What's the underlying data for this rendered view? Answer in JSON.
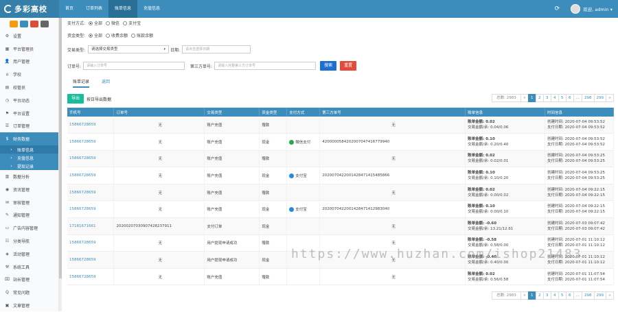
{
  "app": {
    "logo_text": "多彩高校"
  },
  "topnav": {
    "items": [
      {
        "label": "首页",
        "active": false
      },
      {
        "label": "订单列表",
        "active": false
      },
      {
        "label": "账单信息",
        "active": true
      },
      {
        "label": "充值信息",
        "active": false
      }
    ]
  },
  "user": {
    "refresh_icon": "⟳",
    "greeting": "欢迎, admin ▾"
  },
  "sidebar": {
    "items": [
      {
        "icon": "⚙",
        "label": "设置"
      },
      {
        "icon": "▦",
        "label": "平台管理员"
      },
      {
        "icon": "👤",
        "label": "用户管理"
      },
      {
        "icon": "⌂",
        "label": "学校"
      },
      {
        "icon": "▤",
        "label": "校管员"
      },
      {
        "icon": "◷",
        "label": "平台动态"
      },
      {
        "icon": "⚑",
        "label": "平台设置"
      },
      {
        "icon": "☰",
        "label": "订单管理"
      },
      {
        "icon": "$",
        "label": "财务数据",
        "open": true
      },
      {
        "icon": "›",
        "label": "账单信息",
        "sub": true,
        "active": true
      },
      {
        "icon": "›",
        "label": "充值信息",
        "sub": true
      },
      {
        "icon": "›",
        "label": "提现记录",
        "sub": true
      },
      {
        "icon": "▥",
        "label": "数据分析"
      },
      {
        "icon": "◉",
        "label": "资讯管理"
      },
      {
        "icon": "✉",
        "label": "审核管理"
      },
      {
        "icon": "✎",
        "label": "通知管理"
      },
      {
        "icon": "▭",
        "label": "广告内容管理"
      },
      {
        "icon": "☷",
        "label": "分类导航"
      },
      {
        "icon": "◈",
        "label": "活动管理"
      },
      {
        "icon": "⚒",
        "label": "系统工具"
      },
      {
        "icon": "⌧",
        "label": "站长管理"
      },
      {
        "icon": "Q",
        "label": "常见问题"
      },
      {
        "icon": "▣",
        "label": "文章管理"
      }
    ]
  },
  "filters": {
    "pay_method": {
      "label": "支付方式:",
      "options": [
        "全部",
        "微信",
        "支付宝"
      ],
      "selected": 0
    },
    "fund_type": {
      "label": "资金类型:",
      "options": [
        "全部",
        "收费余额",
        "账款余额"
      ],
      "selected": 0
    },
    "trade_type": {
      "label": "交易类型:",
      "value": "请选择交易类型"
    },
    "date": {
      "label": "日期:",
      "placeholder": "请点击选择日期"
    },
    "order_no": {
      "label": "订单号:",
      "placeholder": "请输入订单号"
    },
    "third_no": {
      "label": "第三方单号:",
      "placeholder": "请输入完整第三方订单号"
    },
    "search_label": "搜索",
    "reset_label": "重置"
  },
  "tabs": [
    {
      "label": "账单记录",
      "active": true
    },
    {
      "label": "返回",
      "active": false
    }
  ],
  "export": {
    "button_label": "导出",
    "text": "按日导出数据"
  },
  "pager": {
    "total": "总数: 2983",
    "prev": "«",
    "pages": [
      "1",
      "2",
      "3",
      "4",
      "5",
      "6",
      "...",
      "298",
      "299"
    ],
    "current": "1",
    "next": "»"
  },
  "table": {
    "headers": [
      "手机号",
      "订单号",
      "交易类型",
      "资金类型",
      "支付方式",
      "第三方单号",
      "账单信息",
      "时间信息"
    ],
    "rows": [
      {
        "phone": "15866728659",
        "order": "无",
        "type": "账户充值",
        "fund": "赠款",
        "pay": "",
        "third": "无",
        "amt1": "账单金额: 0.02",
        "amt2": "交易金额/余: 0.04/0.06",
        "t1": "创建时间: 2020-07-04 09:53:52",
        "t2": "支付日期: 2020-07-04 09:53:52"
      },
      {
        "phone": "15866728659",
        "order": "无",
        "type": "账户充值",
        "fund": "现金",
        "pay": "微信支付",
        "payColor": "#2ea44f",
        "third": "4200000584202007047416779940",
        "amt1": "账单金额: 0.10",
        "amt2": "交易金额/余: 0.20/0.40",
        "t1": "创建时间: 2020-07-04 09:53:52",
        "t2": "支付日期: 2020-07-04 09:53:52"
      },
      {
        "phone": "15866728659",
        "order": "无",
        "type": "账户充值",
        "fund": "赠款",
        "pay": "",
        "third": "无",
        "amt1": "账单金额: 0.02",
        "amt2": "交易金额/余: 0.02/0.01",
        "t1": "创建时间: 2020-07-04 09:53:25",
        "t2": "支付日期: 2020-07-04 09:53:25"
      },
      {
        "phone": "15866728659",
        "order": "无",
        "type": "账户充值",
        "fund": "现金",
        "pay": "支付宝",
        "payColor": "#2b8ad8",
        "third": "2020070422001428471415485866",
        "amt1": "账单金额: 0.10",
        "amt2": "交易金额/余: 0.10/0.20",
        "t1": "创建时间: 2020-07-04 09:53:25",
        "t2": "支付日期: 2020-07-04 09:53:25"
      },
      {
        "phone": "15866728659",
        "order": "无",
        "type": "账户充值",
        "fund": "赠款",
        "pay": "",
        "third": "无",
        "amt1": "账单金额: 0.02",
        "amt2": "交易金额/余: 0.00/0.02",
        "t1": "创建时间: 2020-07-04 09:22:15",
        "t2": "支付日期: 2020-07-04 09:22:15"
      },
      {
        "phone": "15866728659",
        "order": "无",
        "type": "账户充值",
        "fund": "现金",
        "pay": "支付宝",
        "payColor": "#2b8ad8",
        "third": "2020070422001428471412983040",
        "amt1": "账单金额: 0.10",
        "amt2": "交易金额/余: 0.00/0.10",
        "t1": "创建时间: 2020-07-04 09:22:15",
        "t2": "支付日期: 2020-07-04 09:22:15"
      },
      {
        "phone": "17181671661",
        "order": "20200207030907428237911",
        "type": "支付订单",
        "fund": "现金",
        "pay": "",
        "third": "无",
        "amt1": "账单金额: -0.60",
        "amt2": "交易金额/余: 13.21/12.61",
        "t1": "创建时间: 2020-07-03 09:07:42",
        "t2": "支付日期: 2020-07-03 09:07:42"
      },
      {
        "phone": "15866728659",
        "order": "无",
        "type": "用户提现申请成功",
        "fund": "赠款",
        "pay": "",
        "third": "无",
        "amt1": "账单金额: -0.58",
        "amt2": "交易金额/余: 0.58/0.00",
        "t1": "创建时间: 2020-07-01 11:10:12",
        "t2": "支付日期: 2020-07-01 11:10:12"
      },
      {
        "phone": "15866728659",
        "order": "无",
        "type": "用户提现申请成功",
        "fund": "现金",
        "pay": "",
        "third": "无",
        "amt1": "账单金额: -0.40",
        "amt2": "交易金额/余: 0.40/0.00",
        "t1": "创建时间: 2020-07-01 11:10:12",
        "t2": "支付日期: 2020-07-01 11:10:12"
      },
      {
        "phone": "15866728659",
        "order": "无",
        "type": "账户充值",
        "fund": "赠款",
        "pay": "",
        "third": "无",
        "amt1": "账单金额: 0.02",
        "amt2": "交易金额/余: 0.56/0.58",
        "t1": "创建时间: 2020-07-01 11:07:54",
        "t2": "支付日期: 2020-07-01 11:07:54"
      }
    ]
  },
  "watermark": "https://www.huzhan.com/ishop21483",
  "colors": {
    "primary": "#3c8dbc",
    "search": "#1e6fd0",
    "reset": "#e14a3c",
    "export": "#1abc9c"
  }
}
